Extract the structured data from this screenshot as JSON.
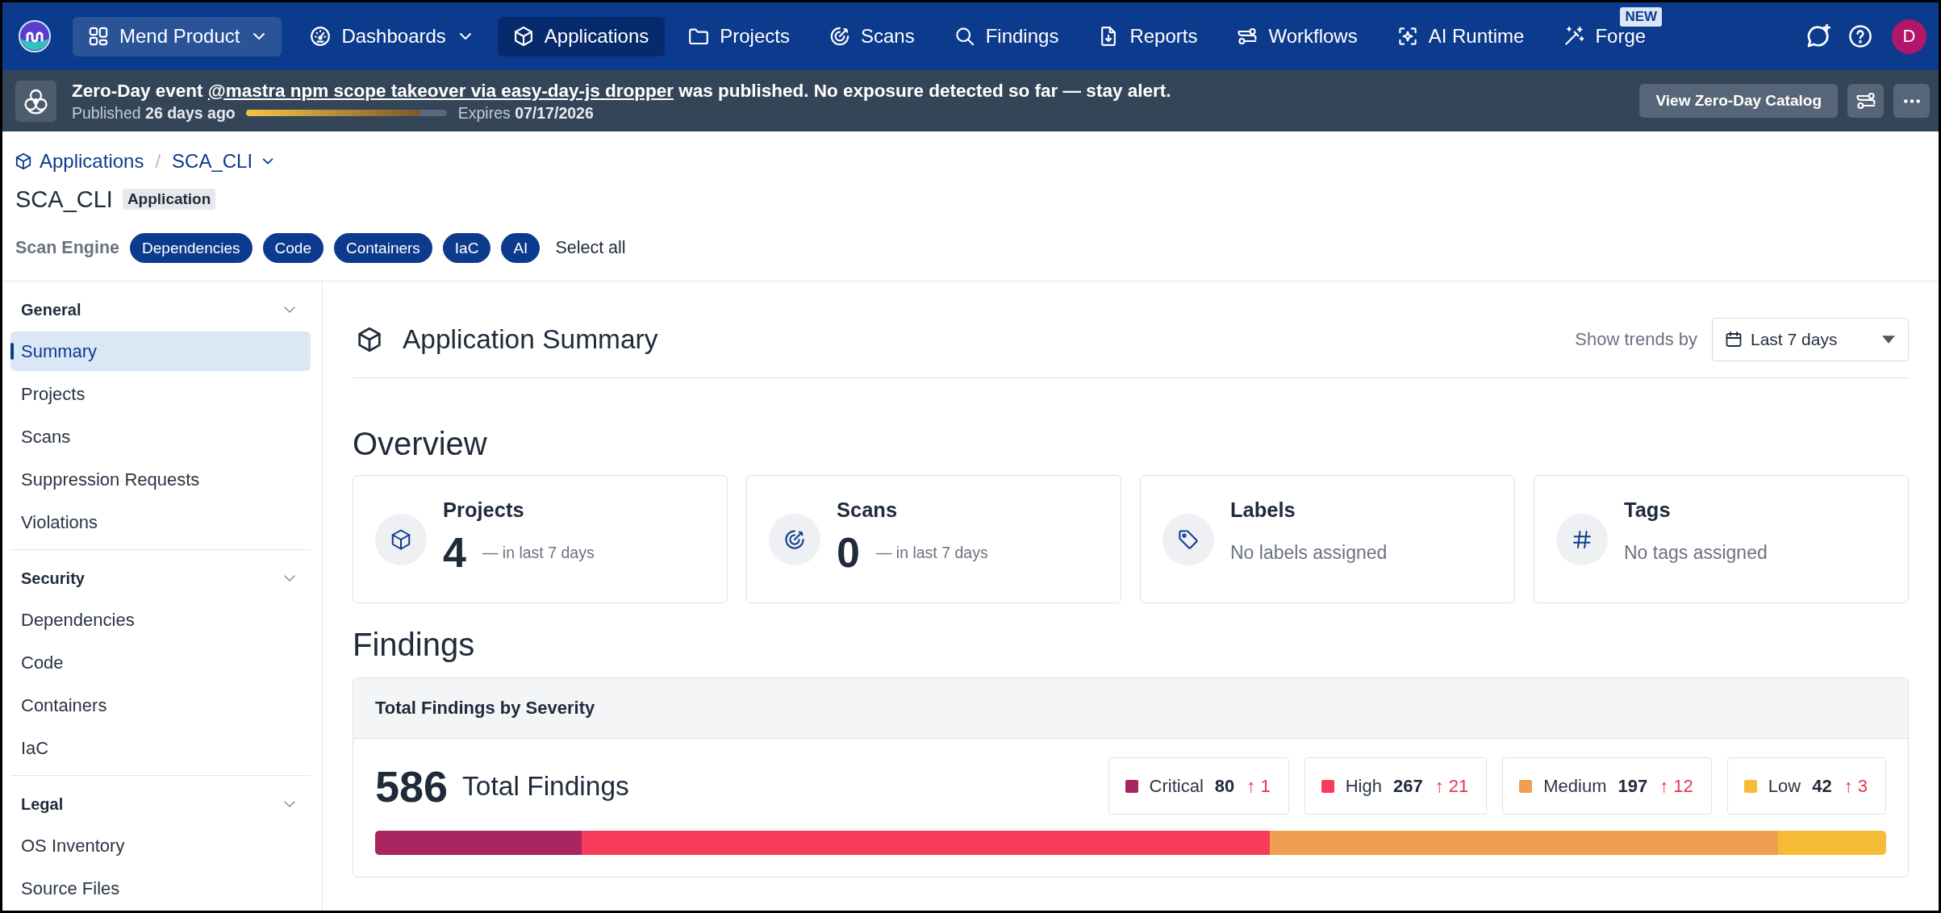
{
  "top_nav": {
    "product_switcher": {
      "label": "Mend Product"
    },
    "items": [
      {
        "label": "Dashboards",
        "selected": false,
        "dropdown": true
      },
      {
        "label": "Applications",
        "selected": true,
        "dropdown": false
      },
      {
        "label": "Projects",
        "selected": false,
        "dropdown": false
      },
      {
        "label": "Scans",
        "selected": false,
        "dropdown": false
      },
      {
        "label": "Findings",
        "selected": false,
        "dropdown": false
      },
      {
        "label": "Reports",
        "selected": false,
        "dropdown": false
      },
      {
        "label": "Workflows",
        "selected": false,
        "dropdown": false
      },
      {
        "label": "AI Runtime",
        "selected": false,
        "dropdown": false
      },
      {
        "label": "Forge",
        "selected": false,
        "dropdown": false,
        "badge": "NEW"
      }
    ],
    "user": {
      "initial": "D"
    }
  },
  "banner": {
    "message": {
      "prefix": "Zero-Day event",
      "link": "@mastra npm scope takeover via easy-day-js dropper",
      "suffix": "was published. No exposure detected so far — stay alert."
    },
    "published": "Published **26 days ago**",
    "progress": {
      "level": 0.87
    },
    "expires": "Expires **07/17/2026**",
    "button": "View Zero-Day Catalog"
  },
  "breadcrumb": {
    "items": [
      {
        "label": "Applications",
        "dropdown": false
      },
      {
        "label": "SCA_CLI",
        "dropdown": true
      }
    ],
    "separator": "/"
  },
  "header": {
    "title": "SCA_CLI",
    "badge": "Application"
  },
  "scan_engine": {
    "label": "Scan Engine",
    "options": [
      {
        "label": "Dependencies",
        "selected": true
      },
      {
        "label": "Code",
        "selected": true
      },
      {
        "label": "Containers",
        "selected": true
      },
      {
        "label": "IaC",
        "selected": true
      },
      {
        "label": "AI",
        "selected": true
      }
    ],
    "select_all": "Select all"
  },
  "sidebar": {
    "groups": [
      {
        "title": "General",
        "expanded": true,
        "items": [
          {
            "label": "Summary",
            "selected": true
          },
          {
            "label": "Projects",
            "selected": false
          },
          {
            "label": "Scans",
            "selected": false
          },
          {
            "label": "Suppression Requests",
            "selected": false
          },
          {
            "label": "Violations",
            "selected": false
          }
        ]
      },
      {
        "title": "Security",
        "expanded": true,
        "items": [
          {
            "label": "Dependencies",
            "selected": false
          },
          {
            "label": "Code",
            "selected": false
          },
          {
            "label": "Containers",
            "selected": false
          },
          {
            "label": "IaC",
            "selected": false
          }
        ]
      },
      {
        "title": "Legal",
        "expanded": true,
        "items": [
          {
            "label": "OS Inventory",
            "selected": false
          },
          {
            "label": "Source Files",
            "selected": false
          }
        ]
      }
    ]
  },
  "summary": {
    "title": "Application Summary",
    "trend_label": "Show trends by",
    "period": "Last 7 days"
  },
  "overview": {
    "title": "Overview",
    "cards": [
      {
        "kind": "count",
        "title": "Projects",
        "value": "4",
        "note": "— in last 7 days"
      },
      {
        "kind": "count",
        "title": "Scans",
        "value": "0",
        "note": "— in last 7 days"
      },
      {
        "kind": "empty",
        "title": "Labels",
        "note": "No labels assigned"
      },
      {
        "kind": "empty",
        "title": "Tags",
        "note": "No tags assigned"
      }
    ]
  },
  "findings": {
    "title": "Findings",
    "panel_title": "Total Findings by Severity",
    "total": "586",
    "total_label": "Total Findings",
    "severities": [
      {
        "label": "Critical",
        "count": "80",
        "trend": "↑ 1",
        "color": "#a8255f"
      },
      {
        "label": "High",
        "count": "267",
        "trend": "↑ 21",
        "color": "#f73c5a"
      },
      {
        "label": "Medium",
        "count": "197",
        "trend": "↑ 12",
        "color": "#f09e4f"
      },
      {
        "label": "Low",
        "count": "42",
        "trend": "↑ 3",
        "color": "#f6bc38"
      }
    ]
  }
}
